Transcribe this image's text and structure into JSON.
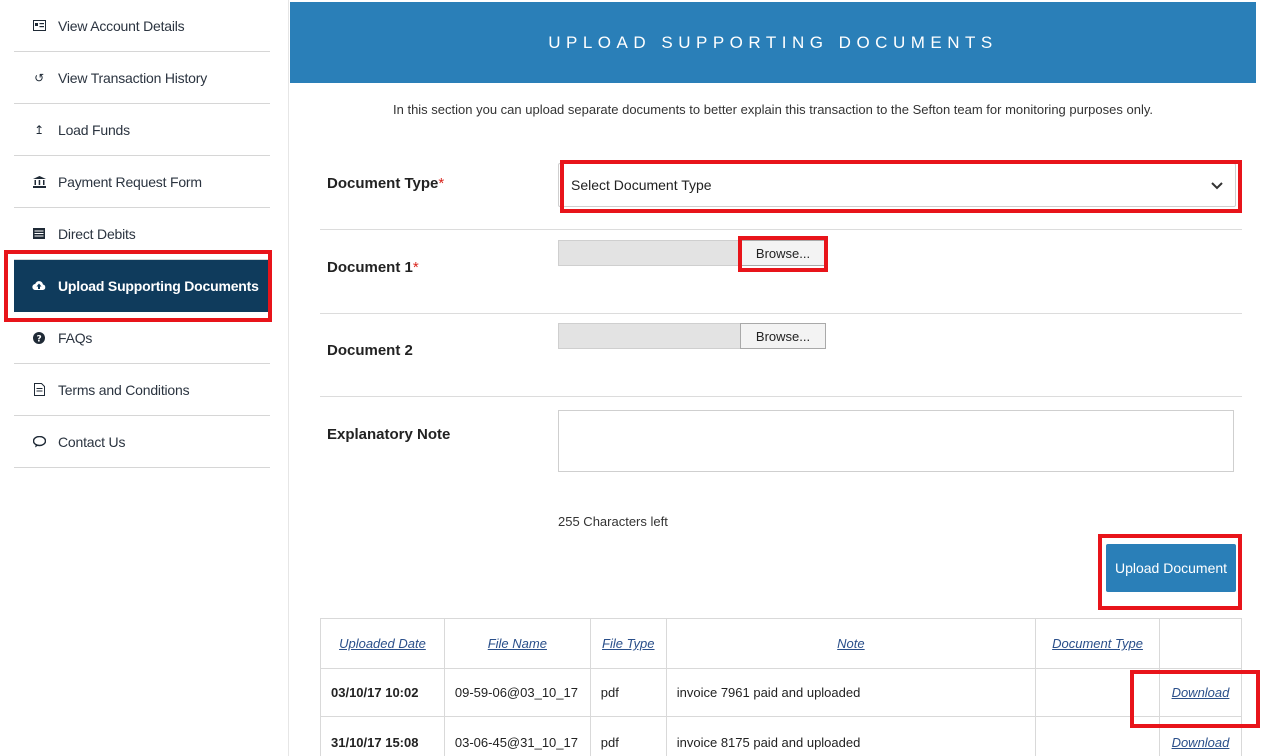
{
  "sidebar": {
    "items": [
      {
        "label": "View Account Details",
        "icon": "id-card-icon"
      },
      {
        "label": "View Transaction History",
        "icon": "history-icon"
      },
      {
        "label": "Load Funds",
        "icon": "upload-arrow-icon"
      },
      {
        "label": "Payment Request Form",
        "icon": "bank-icon"
      },
      {
        "label": "Direct Debits",
        "icon": "list-icon"
      },
      {
        "label": "Upload Supporting Documents",
        "icon": "cloud-upload-icon"
      },
      {
        "label": "FAQs",
        "icon": "question-icon"
      },
      {
        "label": "Terms and Conditions",
        "icon": "document-icon"
      },
      {
        "label": "Contact Us",
        "icon": "chat-icon"
      }
    ]
  },
  "header": {
    "title": "UPLOAD SUPPORTING DOCUMENTS"
  },
  "intro": "In this section you can upload separate documents to better explain this transaction to the Sefton team for monitoring purposes only.",
  "form": {
    "document_type_label": "Document Type",
    "required_mark": "*",
    "document_type_placeholder": "Select Document Type",
    "document1_label": "Document 1",
    "document2_label": "Document 2",
    "browse_label": "Browse...",
    "note_label": "Explanatory Note",
    "chars_left": "255 Characters left",
    "upload_button": "Upload Document"
  },
  "table": {
    "headers": [
      "Uploaded Date",
      "File Name",
      "File Type",
      "Note",
      "Document Type",
      ""
    ],
    "rows": [
      {
        "date": "03/10/17  10:02",
        "file_name": "09-59-06@03_10_17",
        "file_type": "pdf",
        "note": "invoice 7961 paid and uploaded",
        "doc_type": "",
        "action": "Download"
      },
      {
        "date": "31/10/17  15:08",
        "file_name": "03-06-45@31_10_17",
        "file_type": "pdf",
        "note": "invoice 8175 paid and uploaded",
        "doc_type": "",
        "action": "Download"
      }
    ]
  },
  "colors": {
    "header_blue": "#2a7fb8",
    "active_nav": "#0f3b5c",
    "highlight_red": "#e8141a"
  }
}
